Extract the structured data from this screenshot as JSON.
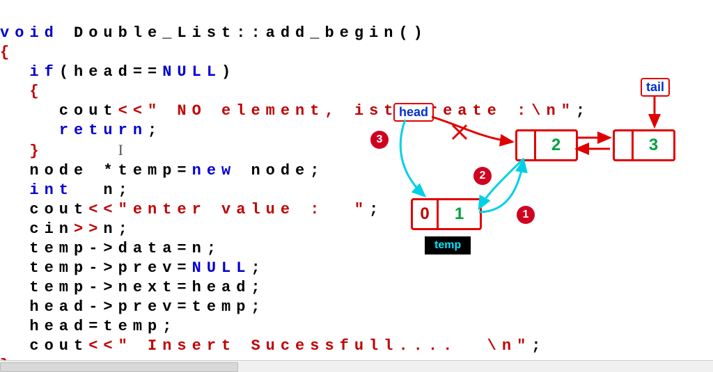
{
  "code": {
    "l1": {
      "void": "void",
      "rest": " Double_List::add_begin()"
    },
    "l2": "{",
    "l3": {
      "pre": "  ",
      "if": "if",
      "open": "(head==",
      "null": "NULL",
      "close": ")"
    },
    "l4": "  {",
    "l5": {
      "pre": "    cout",
      "op": "<<",
      "str": "\" NO element, ist create :\\n\"",
      "semi": ";"
    },
    "l6": {
      "pre": "    ",
      "ret": "return",
      "semi": ";"
    },
    "l7": "  }",
    "l8": {
      "pre": "  node *temp=",
      "new": "new",
      "post": " node;"
    },
    "l9": {
      "pre": "  ",
      "int": "int",
      "post": "  n;"
    },
    "l10": {
      "pre": "  cout",
      "op": "<<",
      "str": "\"enter value :  \"",
      "semi": ";"
    },
    "l11": {
      "pre": "  cin",
      "op": ">>",
      "post": "n;"
    },
    "l12": "  temp->data=n;",
    "l13": {
      "pre": "  temp->prev=",
      "null": "NULL",
      "semi": ";"
    },
    "l14": "  temp->next=head;",
    "l15": "  head->prev=temp;",
    "l16": "  head=temp;",
    "l17": {
      "pre": "  cout",
      "op": "<<",
      "str": "\" Insert Sucessfull....  \\n\"",
      "semi": ";"
    },
    "l18": "}"
  },
  "diagram": {
    "head_label": "head",
    "tail_label": "tail",
    "temp_label": "temp",
    "temp_prev": "0",
    "temp_val": "1",
    "node2_val": "2",
    "node3_val": "3",
    "step1": "1",
    "step2": "2",
    "step3": "3"
  }
}
